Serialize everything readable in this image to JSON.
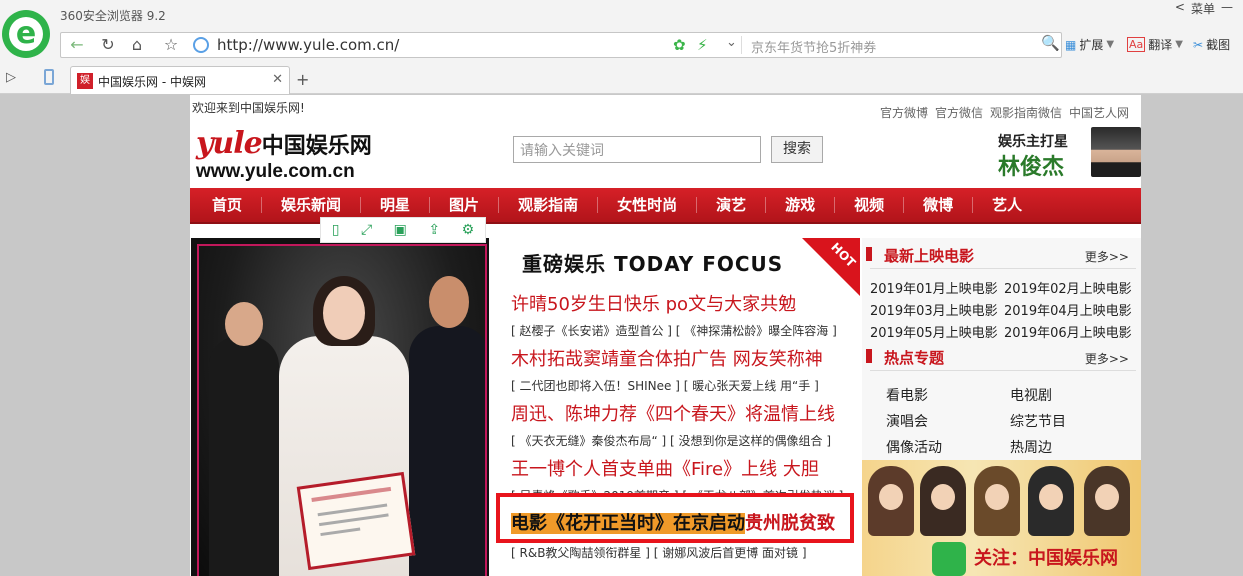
{
  "browser": {
    "app_title": "360安全浏览器 9.2",
    "window_controls": [
      "<",
      "菜单",
      "—"
    ],
    "url": "http://www.yule.com.cn/",
    "search_hint": "京东年货节抢5折神券",
    "tools": {
      "extend": "扩展",
      "translate": "翻译",
      "screenshot": "截图"
    },
    "tab_title": "中国娱乐网 - 中娱网",
    "tab_favicon": "娱"
  },
  "site": {
    "welcome": "欢迎来到中国娱乐网!",
    "top_links": [
      "官方微博",
      "官方微信",
      "观影指南微信",
      "中国艺人网"
    ],
    "logo": {
      "yule": "yule",
      "cn": "中国娱乐网",
      "domain": "www.yule.com.cn"
    },
    "search_placeholder": "请输入关键词",
    "search_button": "搜索",
    "promo": {
      "line1": "娱乐主打星",
      "line2": "林俊杰"
    },
    "nav": [
      "首页",
      "娱乐新闻",
      "明星",
      "图片",
      "观影指南",
      "女性时尚",
      "演艺",
      "游戏",
      "视频",
      "微博",
      "艺人"
    ]
  },
  "focus": {
    "title": "重磅娱乐  TODAY FOCUS",
    "hot": "HOT",
    "items": [
      {
        "head": "许晴50岁生日快乐 po文与大家共勉",
        "sub": "[ 赵樱子《长安诺》造型首公 ] [ 《神探蒲松龄》曝全阵容海 ]"
      },
      {
        "head": "木村拓哉窦靖童合体拍广告 网友笑称神",
        "sub": "[ 二代团也即将入伍！SHINee ] [ 暖心张天爱上线 用“手 ]"
      },
      {
        "head": "周迅、陈坤力荐《四个春天》将温情上线",
        "sub": "[ 《天衣无缝》秦俊杰布局“ ] [ 没想到你是这样的偶像组合 ]"
      },
      {
        "head": "王一博个人首支单曲《Fire》上线 大胆",
        "sub": "[ 吴青峰《歌手》2019首期音 ] [ 《天龙八部》首次引发热议 ]"
      }
    ],
    "highlight": {
      "marked": "电影《花开正当时》在京启动",
      "rest": "贵州脱贫致"
    },
    "last_sub": "[ R&B教父陶喆领衔群星 ] [ 谢娜风波后首更博 面对镜 ]"
  },
  "right": {
    "latest_movies": {
      "title": "最新上映电影",
      "more": "更多>>",
      "items": [
        "2019年01月上映电影",
        "2019年02月上映电影",
        "2019年03月上映电影",
        "2019年04月上映电影",
        "2019年05月上映电影",
        "2019年06月上映电影"
      ]
    },
    "hot_topics": {
      "title": "热点专题",
      "more": "更多>>",
      "items": [
        "看电影",
        "电视剧",
        "演唱会",
        "综艺节目",
        "偶像活动",
        "热周边"
      ]
    },
    "banner_text": "关注：中国娱乐网"
  },
  "colors": {
    "brand_red": "#c8161d",
    "nav_red": "#d62027",
    "highlight_orange": "#f09a29",
    "browser_green": "#2fb34a"
  }
}
